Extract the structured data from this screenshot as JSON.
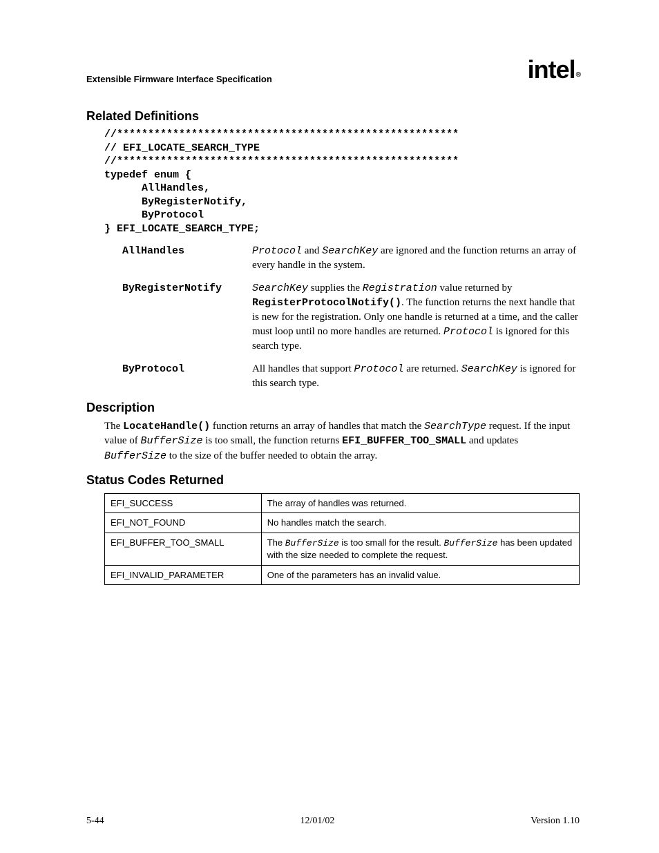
{
  "header": {
    "title": "Extensible Firmware Interface Specification",
    "logo_text": "int",
    "logo_suffix": "el"
  },
  "sections": {
    "related_defs": "Related Definitions",
    "description": "Description",
    "status_codes": "Status Codes Returned"
  },
  "code": {
    "line1": "//*******************************************************",
    "line2": "// EFI_LOCATE_SEARCH_TYPE",
    "line3": "//*******************************************************",
    "line4": "typedef enum {",
    "line5": "      AllHandles,",
    "line6": "      ByRegisterNotify,",
    "line7": "      ByProtocol",
    "line8": "} EFI_LOCATE_SEARCH_TYPE;"
  },
  "defs": [
    {
      "term": "AllHandles",
      "parts": {
        "p1": "Protocol",
        "p2": " and ",
        "p3": "SearchKey",
        "p4": " are ignored and the function returns an array of every handle in the system."
      }
    },
    {
      "term": "ByRegisterNotify",
      "parts": {
        "p1": "SearchKey",
        "p2": " supplies the ",
        "p3": "Registration",
        "p4": " value returned by ",
        "p5": "RegisterProtocolNotify()",
        "p6": ".  The function returns the next handle that is new for the registration.  Only one handle is returned at a time, and the caller must loop until no more handles are returned.  ",
        "p7": "Protocol",
        "p8": " is ignored for this search type."
      }
    },
    {
      "term": "ByProtocol",
      "parts": {
        "p1": "All handles that support ",
        "p2": "Protocol",
        "p3": " are returned.  ",
        "p4": "SearchKey",
        "p5": " is ignored for this search type."
      }
    }
  ],
  "desc": {
    "t1": "The ",
    "t2": "LocateHandle()",
    "t3": " function returns an array of handles that match the ",
    "t4": "SearchType",
    "t5": " request.  If the input value of ",
    "t6": "BufferSize",
    "t7": " is too small, the function returns ",
    "t8": "EFI_BUFFER_TOO_SMALL",
    "t9": " and updates ",
    "t10": "BufferSize",
    "t11": " to the size of the buffer needed to obtain the array."
  },
  "status": [
    {
      "code": "EFI_SUCCESS",
      "desc_plain": "The array of handles was returned."
    },
    {
      "code": "EFI_NOT_FOUND",
      "desc_plain": "No handles match the search."
    },
    {
      "code": "EFI_BUFFER_TOO_SMALL",
      "d1": "The ",
      "d2": "BufferSize",
      "d3": " is too small for the result.  ",
      "d4": "BufferSize",
      "d5": " has been updated with the size needed to complete the request."
    },
    {
      "code": "EFI_INVALID_PARAMETER",
      "desc_plain": "One of the parameters has an invalid value."
    }
  ],
  "footer": {
    "left": "5-44",
    "center": "12/01/02",
    "right": "Version 1.10"
  }
}
